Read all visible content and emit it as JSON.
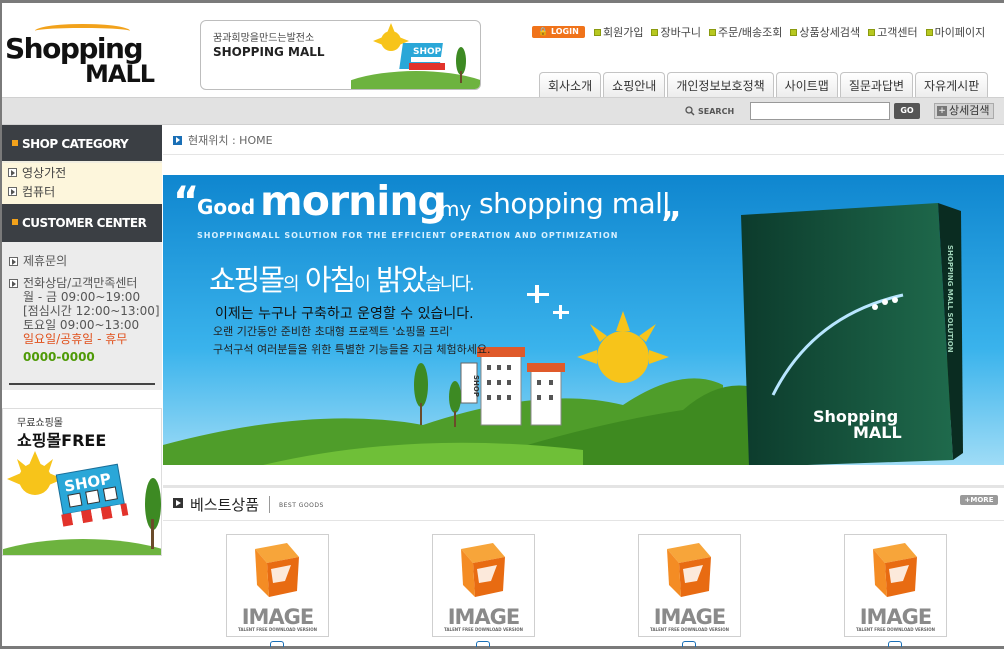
{
  "logo": {
    "line1": "Shopping",
    "line2": "MALL"
  },
  "top_banner": {
    "tagline": "꿈과희망을만드는발전소",
    "title": "SHOPPING MALL",
    "shop_sign": "SHOP"
  },
  "top_links": {
    "login": "LOGIN",
    "items": [
      "회원가입",
      "장바구니",
      "주문/배송조회",
      "상품상세검색",
      "고객센터",
      "마이페이지"
    ]
  },
  "nav_tabs": [
    "회사소개",
    "쇼핑안내",
    "개인정보보호정책",
    "사이트맵",
    "질문과답변",
    "자유게시판"
  ],
  "search": {
    "label": "SEARCH",
    "value": "",
    "go": "GO",
    "advanced": "상세검색"
  },
  "sidebar": {
    "category_title": "SHOP CATEGORY",
    "categories": [
      "영상가전",
      "컴퓨터"
    ],
    "customer_title": "CUSTOMER CENTER",
    "partnership": "제휴문의",
    "phone_center": "전화상담/고객만족센터",
    "hours_weekday": "월 - 금 09:00~19:00",
    "hours_lunch": "[점심시간 12:00~13:00]",
    "hours_saturday": "토요일 09:00~13:00",
    "hours_closed": "일요일/공휴일 - 휴무",
    "phone_number": "0000-0000",
    "ad_small": "무료쇼핑몰",
    "ad_big_kor": "쇼핑몰",
    "ad_big_eng": "FREE",
    "ad_sign": "SHOP"
  },
  "breadcrumb": {
    "label": "현재위치 : HOME"
  },
  "hero": {
    "good": "Good",
    "morning": "morning",
    "my": "my",
    "mall": "shopping mall",
    "subtitle": "SHOPPINGMALL SOLUTION FOR THE EFFICIENT OPERATION AND OPTIMIZATION",
    "headline_a": "쇼핑몰",
    "headline_b": "의",
    "headline_c": "아침",
    "headline_d": "이",
    "headline_e": "밝았",
    "headline_f": "습니다.",
    "line1": "이제는 누구나 구축하고 운영할 수 있습니다.",
    "line2": "오랜 기간동안 준비한 초대형 프로젝트 '쇼핑몰 프리'",
    "line3": "구석구석 여러분들을 위한 특별한 기능들을 지금 체험하세요.",
    "box_title_1": "Shopping",
    "box_title_2": "MALL",
    "box_side": "SHOPPING MALL SOLUTION",
    "shop_sign": "SHOP"
  },
  "best": {
    "title": "베스트상품",
    "subtitle": "BEST GOODS",
    "more": "MORE"
  },
  "products": [
    {
      "image_text": "IMAGE",
      "image_sub": "TALENT FREE DOWNLOAD VERSION"
    },
    {
      "image_text": "IMAGE",
      "image_sub": "TALENT FREE DOWNLOAD VERSION"
    },
    {
      "image_text": "IMAGE",
      "image_sub": "TALENT FREE DOWNLOAD VERSION"
    },
    {
      "image_text": "IMAGE",
      "image_sub": "TALENT FREE DOWNLOAD VERSION"
    }
  ],
  "colors": {
    "accent_orange": "#f0731a",
    "sky_blue": "#29a6e6",
    "grass_green": "#5aa62a",
    "nav_dark": "#3b3f44"
  }
}
